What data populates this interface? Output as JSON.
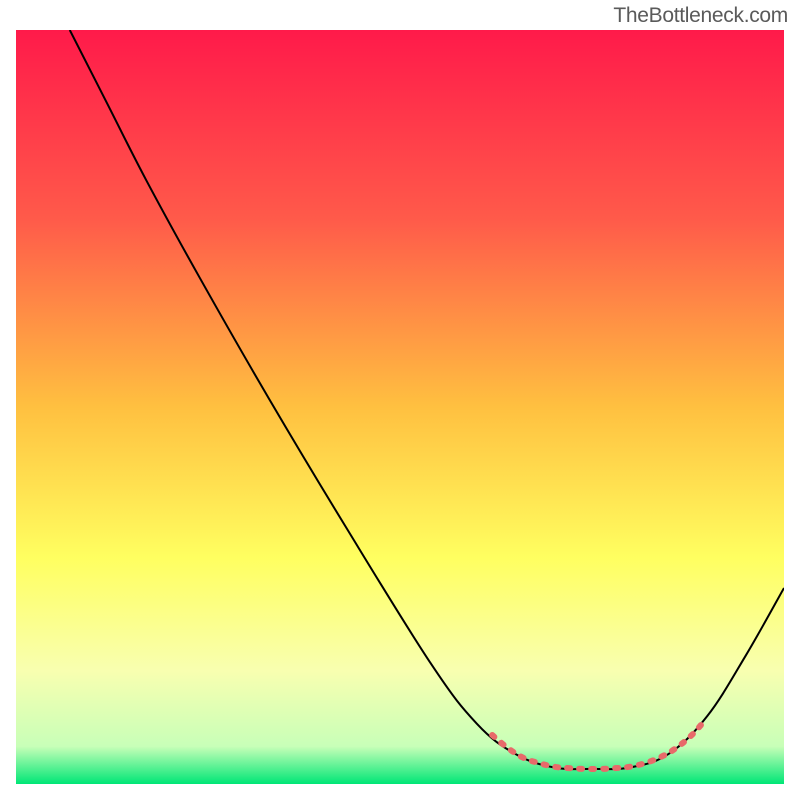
{
  "watermark": "TheBottleneck.com",
  "chart_data": {
    "type": "line",
    "title": "",
    "xlabel": "",
    "ylabel": "",
    "xlim": [
      0,
      100
    ],
    "ylim": [
      0,
      100
    ],
    "background_gradient": {
      "stops": [
        {
          "offset": 0,
          "color": "#ff1a4a"
        },
        {
          "offset": 25,
          "color": "#ff5a4a"
        },
        {
          "offset": 50,
          "color": "#ffc040"
        },
        {
          "offset": 70,
          "color": "#ffff60"
        },
        {
          "offset": 85,
          "color": "#f8ffb0"
        },
        {
          "offset": 95,
          "color": "#c8ffb8"
        },
        {
          "offset": 100,
          "color": "#00e676"
        }
      ]
    },
    "series": [
      {
        "name": "curve",
        "stroke": "#000000",
        "stroke_width": 2,
        "points": [
          {
            "x": 7,
            "y": 100
          },
          {
            "x": 12,
            "y": 90
          },
          {
            "x": 17,
            "y": 80
          },
          {
            "x": 24,
            "y": 67
          },
          {
            "x": 33,
            "y": 51
          },
          {
            "x": 43,
            "y": 34
          },
          {
            "x": 54,
            "y": 16
          },
          {
            "x": 60,
            "y": 8
          },
          {
            "x": 65,
            "y": 4
          },
          {
            "x": 70,
            "y": 2.2
          },
          {
            "x": 75,
            "y": 2
          },
          {
            "x": 80,
            "y": 2.2
          },
          {
            "x": 85,
            "y": 4
          },
          {
            "x": 90,
            "y": 9
          },
          {
            "x": 95,
            "y": 17
          },
          {
            "x": 100,
            "y": 26
          }
        ]
      }
    ],
    "dot_annotations": {
      "stroke": "#e86a6a",
      "stroke_width": 6,
      "dash": "3,9",
      "points": [
        {
          "x": 62,
          "y": 6.5
        },
        {
          "x": 64,
          "y": 4.8
        },
        {
          "x": 66,
          "y": 3.5
        },
        {
          "x": 68,
          "y": 2.8
        },
        {
          "x": 70,
          "y": 2.3
        },
        {
          "x": 72,
          "y": 2.1
        },
        {
          "x": 74,
          "y": 2.0
        },
        {
          "x": 76,
          "y": 2.0
        },
        {
          "x": 78,
          "y": 2.1
        },
        {
          "x": 80,
          "y": 2.3
        },
        {
          "x": 82,
          "y": 2.8
        },
        {
          "x": 84,
          "y": 3.6
        },
        {
          "x": 86,
          "y": 4.8
        },
        {
          "x": 88,
          "y": 6.5
        },
        {
          "x": 89.5,
          "y": 8.2
        }
      ]
    }
  }
}
